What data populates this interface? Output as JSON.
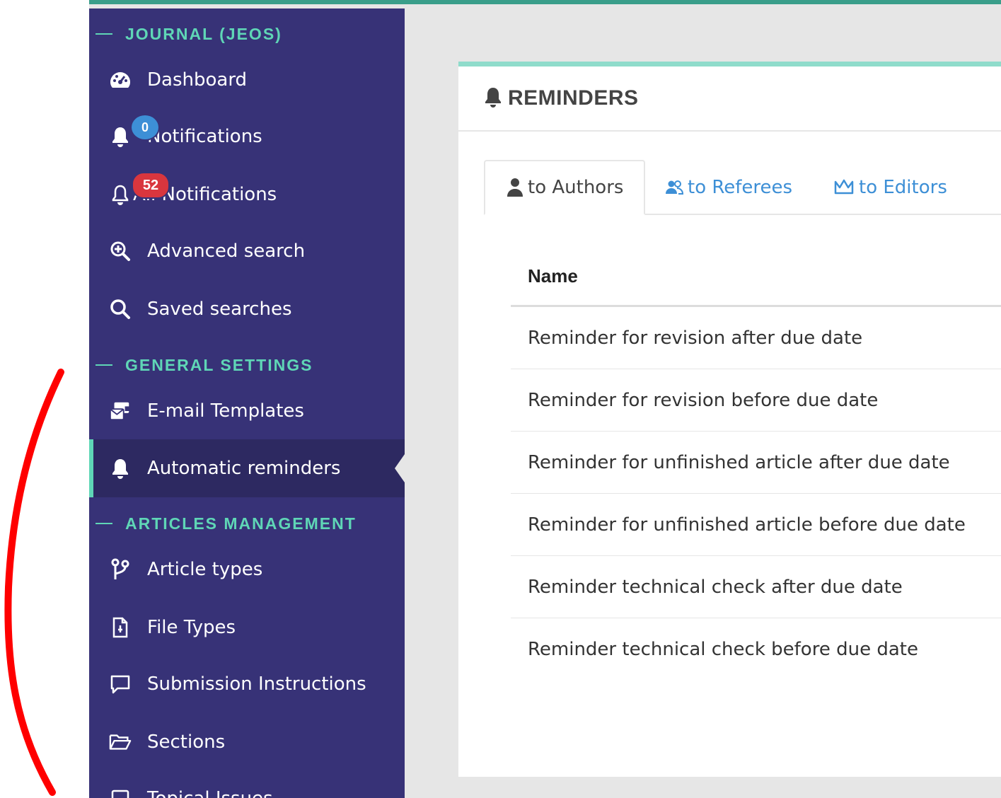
{
  "sidebar": {
    "sections": {
      "journal": "JOURNAL (JEOS)",
      "general": "GENERAL SETTINGS",
      "articles": "ARTICLES MANAGEMENT"
    },
    "items": {
      "dashboard": "Dashboard",
      "notifications": "Notifications",
      "notifications_badge": "0",
      "all_notifications": "All Notifications",
      "all_notifications_badge": "52",
      "advanced_search": "Advanced search",
      "saved_searches": "Saved searches",
      "email_templates": "E-mail Templates",
      "automatic_reminders": "Automatic reminders",
      "article_types": "Article types",
      "file_types": "File Types",
      "submission_instructions": "Submission Instructions",
      "sections": "Sections",
      "topical_issues": "Topical Issues"
    }
  },
  "panel": {
    "title": "REMINDERS",
    "tabs": [
      "to Authors",
      "to Referees",
      "to Editors"
    ],
    "active_tab": "to Authors",
    "table": {
      "header": "Name",
      "rows": [
        "Reminder for revision after due date",
        "Reminder for revision before due date",
        "Reminder for unfinished article after due date",
        "Reminder for unfinished article before due date",
        "Reminder technical check after due date",
        "Reminder technical check before due date"
      ]
    }
  },
  "colors": {
    "sidebar_bg": "#373277",
    "accent": "#5fd6b6",
    "link": "#3d8fd6",
    "badge_blue": "#3d8fd6",
    "badge_red": "#d9363e",
    "annotation": "#ff0000"
  }
}
